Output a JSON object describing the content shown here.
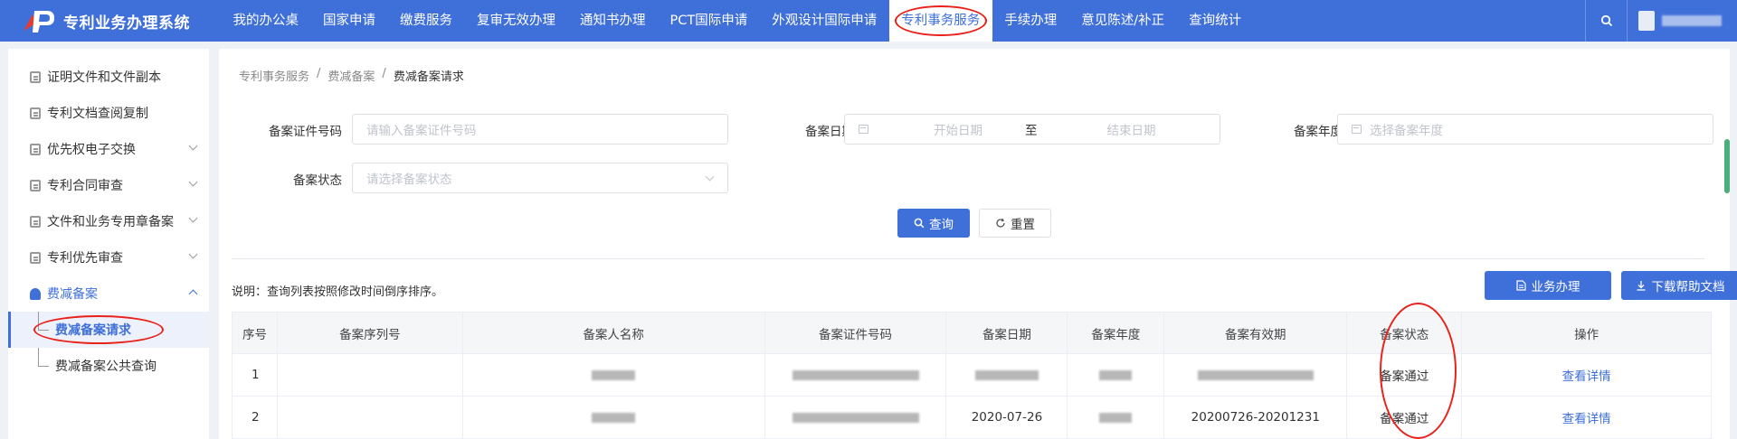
{
  "header": {
    "title": "专利业务办理系统",
    "nav": [
      {
        "label": "我的办公桌"
      },
      {
        "label": "国家申请"
      },
      {
        "label": "缴费服务"
      },
      {
        "label": "复审无效办理"
      },
      {
        "label": "通知书办理"
      },
      {
        "label": "PCT国际申请"
      },
      {
        "label": "外观设计国际申请"
      },
      {
        "label": "专利事务服务",
        "active": true
      },
      {
        "label": "手续办理"
      },
      {
        "label": "意见陈述/补正"
      },
      {
        "label": "查询统计"
      }
    ],
    "accent": "#3f6fd8"
  },
  "sidebar": {
    "items": [
      {
        "label": "证明文件和文件副本"
      },
      {
        "label": "专利文档查阅复制"
      },
      {
        "label": "优先权电子交换"
      },
      {
        "label": "专利合同审查"
      },
      {
        "label": "文件和业务专用章备案"
      },
      {
        "label": "专利优先审查"
      },
      {
        "label": "费减备案"
      }
    ],
    "subitems": [
      {
        "label": "费减备案请求",
        "active": true
      },
      {
        "label": "费减备案公共查询"
      }
    ]
  },
  "breadcrumb": [
    "专利事务服务",
    "/",
    "费减备案",
    "/",
    "费减备案请求"
  ],
  "form": {
    "cert_label": "备案证件号码",
    "cert_placeholder": "请输入备案证件号码",
    "date_label": "备案日期",
    "date_start": "开始日期",
    "date_sep": "至",
    "date_end": "结束日期",
    "year_label": "备案年度",
    "year_placeholder": "选择备案年度",
    "status_label": "备案状态",
    "status_placeholder": "请选择备案状态",
    "search_btn": "查询",
    "reset_btn": "重置"
  },
  "note": "说明：查询列表按照修改时间倒序排序。",
  "actions": {
    "process_btn": "业务办理",
    "download_btn": "下载帮助文档"
  },
  "table": {
    "columns": [
      "序号",
      "备案序列号",
      "备案人名称",
      "备案证件号码",
      "备案日期",
      "备案年度",
      "备案有效期",
      "备案状态",
      "操作"
    ],
    "rows": [
      {
        "index": "1",
        "date": "",
        "validity": "",
        "status": "备案通过",
        "action": "查看详情"
      },
      {
        "index": "2",
        "date": "2020-07-26",
        "validity": "20200726-20201231",
        "status": "备案通过",
        "action": "查看详情"
      }
    ]
  }
}
